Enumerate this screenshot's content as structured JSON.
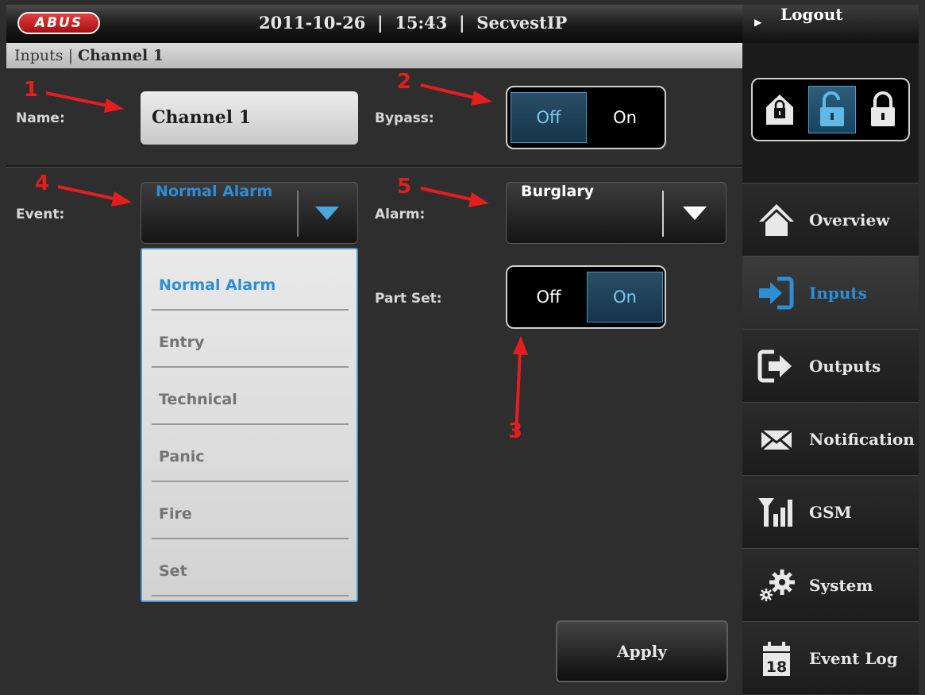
{
  "header": {
    "logo_text": "ABUS",
    "status_line": "2011-10-26  |  15:43  |  SecvestIP"
  },
  "breadcrumb": {
    "section": "Inputs",
    "separator": " | ",
    "current": "Channel 1"
  },
  "sidebar": {
    "logout_label": "Logout",
    "lock_modes": [
      "unlocked",
      "part-set",
      "full-set"
    ],
    "active_lock_mode": "part-set",
    "items": [
      {
        "label": "Overview",
        "icon": "home-icon"
      },
      {
        "label": "Inputs",
        "icon": "input-icon",
        "active": true
      },
      {
        "label": "Outputs",
        "icon": "output-icon"
      },
      {
        "label": "Notification",
        "icon": "envelope-icon"
      },
      {
        "label": "GSM",
        "icon": "signal-icon"
      },
      {
        "label": "System",
        "icon": "gear-icon"
      },
      {
        "label": "Event Log",
        "icon": "calendar-icon",
        "calendar_day": "18"
      }
    ]
  },
  "form": {
    "name_label": "Name:",
    "name_value": "Channel 1",
    "bypass_label": "Bypass:",
    "bypass": {
      "off": "Off",
      "on": "On",
      "selected": "Off"
    },
    "event_label": "Event:",
    "event_value": "Normal Alarm",
    "alarm_label": "Alarm:",
    "alarm_value": "Burglary",
    "partset_label": "Part Set:",
    "partset": {
      "off": "Off",
      "on": "On",
      "selected": "On"
    },
    "event_options": [
      "Normal Alarm",
      "Entry",
      "Technical",
      "Panic",
      "Fire",
      "Set"
    ],
    "apply_label": "Apply"
  },
  "annotations": [
    "1",
    "2",
    "3",
    "4",
    "5"
  ],
  "colors": {
    "accent": "#2c8fd6",
    "annotation": "#e41e1e",
    "background": "#2e2e2e"
  }
}
